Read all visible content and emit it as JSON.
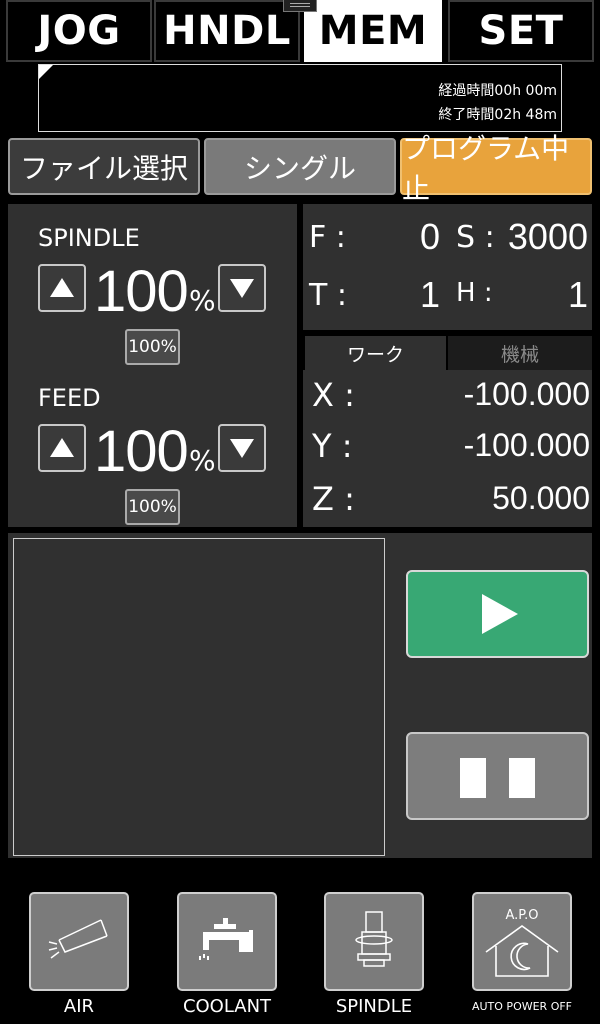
{
  "tabs": [
    "JOG",
    "HNDL",
    "MEM",
    "SET"
  ],
  "active_tab": "MEM",
  "program": {
    "elapsed": "経過時間00h 00m",
    "remaining": "終了時間02h 48m"
  },
  "actions": {
    "file_select": "ファイル選択",
    "single": "シングル",
    "program_stop": "プログラム中止"
  },
  "override": {
    "spindle": {
      "label": "SPINDLE",
      "value": "100",
      "unit": "%",
      "reset": "100%"
    },
    "feed": {
      "label": "FEED",
      "value": "100",
      "unit": "%",
      "reset": "100%"
    }
  },
  "status": {
    "f_label": "F :",
    "f_value": "0",
    "s_label": "S :",
    "s_value": "3000",
    "t_label": "T :",
    "t_value": "1",
    "h_label": "H :",
    "h_value": "1"
  },
  "coords": {
    "tabs": [
      "ワーク",
      "機械"
    ],
    "active": "ワーク",
    "x_label": "X :",
    "x": "-100.000",
    "y_label": "Y :",
    "y": "-100.000",
    "z_label": "Z :",
    "z": "50.000"
  },
  "bottom": {
    "air": "AIR",
    "coolant": "COOLANT",
    "spindle": "SPINDLE",
    "apo_badge": "A.P.O",
    "apo": "AUTO POWER OFF"
  },
  "colors": {
    "background": "#000000",
    "panel": "#303030",
    "start": "#38a874",
    "stop": "#e8a33c",
    "button_gray": "#7b7b7b"
  }
}
